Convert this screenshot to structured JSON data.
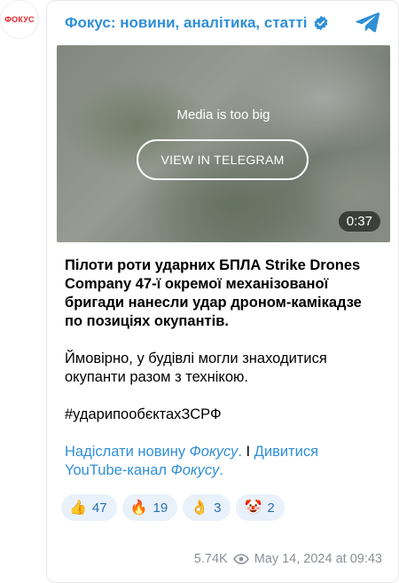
{
  "avatar": {
    "text": "ФОКУС"
  },
  "channel": {
    "title": "Фокус: новини, аналітика, статті"
  },
  "media": {
    "message": "Media is too big",
    "button_label": "VIEW IN TELEGRAM",
    "duration": "0:37"
  },
  "post": {
    "headline": "Пілоти роти ударних БПЛА Strike Drones Company 47-ї окремої механізованої бригади нанесли удар дроном-камікадзе по позиціях окупантів.",
    "body": "Ймовірно, у будівлі могли знаходитися окупанти разом з технікою.",
    "hashtag": "#ударипообєктахЗСРФ",
    "link1_prefix": "Надіслати новину ",
    "link1_em": "Фокусу",
    "link1_suffix": ".",
    "separator": " I ",
    "link2_prefix": "Дивитися YouTube-канал ",
    "link2_em": "Фокусу",
    "link2_suffix": "."
  },
  "reactions": [
    {
      "emoji": "👍",
      "icon": "thumbs-up-icon",
      "count": "47"
    },
    {
      "emoji": "🔥",
      "icon": "fire-icon",
      "count": "19"
    },
    {
      "emoji": "👌",
      "icon": "ok-hand-icon",
      "count": "3"
    },
    {
      "emoji": "🤡",
      "icon": "clown-icon",
      "count": "2"
    }
  ],
  "meta": {
    "views": "5.74K",
    "date": "May 14, 2024 at 09:43"
  },
  "colors": {
    "accent": "#2f8fd7",
    "reaction_bg": "#e9f1fa",
    "brand_red": "#e3222b"
  }
}
